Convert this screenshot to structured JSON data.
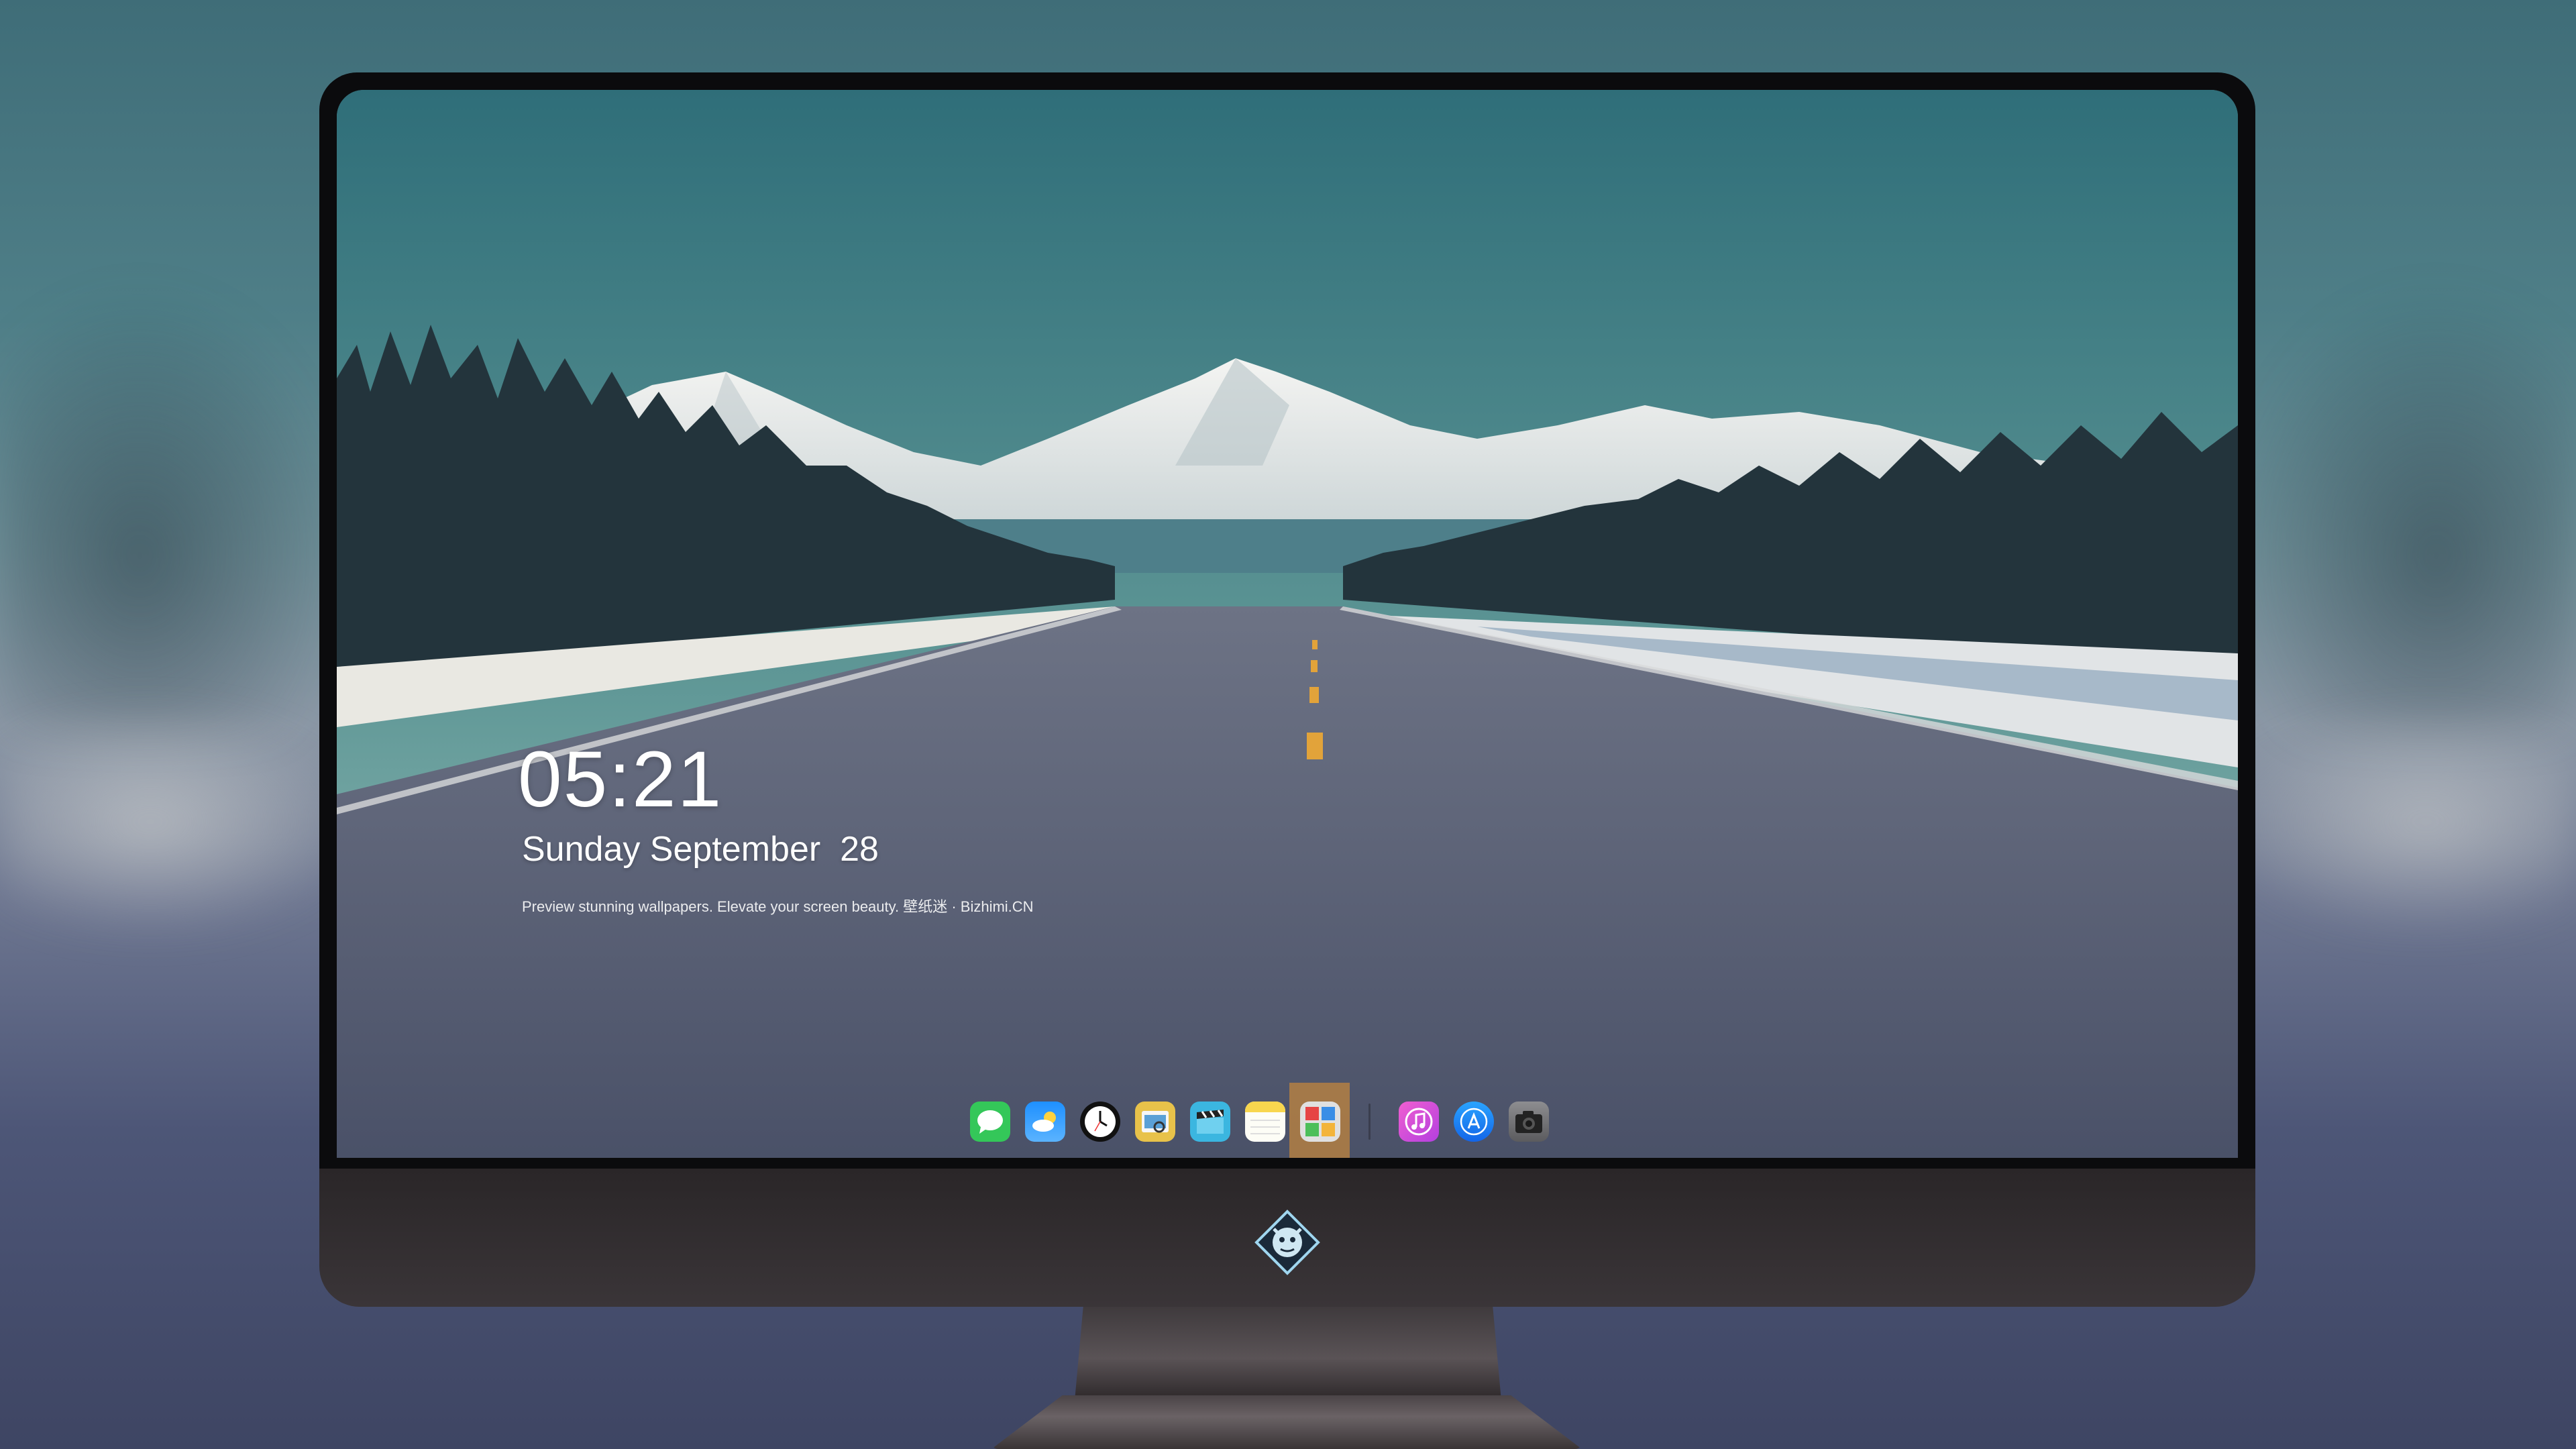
{
  "lockscreen": {
    "time": "05:21",
    "date": "Sunday September  28",
    "tagline": "Preview stunning wallpapers. Elevate your screen beauty. 壁纸迷 · Bizhimi.CN"
  },
  "dock": {
    "apps": [
      {
        "name": "messages-icon",
        "color": "#34c759"
      },
      {
        "name": "weather-icon",
        "color": "#1e90ff"
      },
      {
        "name": "clock-icon",
        "color": "#111111"
      },
      {
        "name": "preview-icon",
        "color": "#e8c24a"
      },
      {
        "name": "clips-icon",
        "color": "#3bb6e0"
      },
      {
        "name": "notes-icon",
        "color": "#f8d64e"
      },
      {
        "name": "photo-booth-icon",
        "color": "#e0e0e0"
      }
    ],
    "pinned": [
      {
        "name": "itunes-icon",
        "color": "#e64fb9"
      },
      {
        "name": "app-store-icon",
        "color": "#1f8ef7"
      },
      {
        "name": "camera-icon",
        "color": "#6b6b6e"
      }
    ]
  },
  "colors": {
    "sky_top": "#2f6e79",
    "sky_bottom": "#8fb9b5",
    "road": "#5a6276",
    "lane_marking": "#e2a33a",
    "snow": "#e9e8e2"
  }
}
